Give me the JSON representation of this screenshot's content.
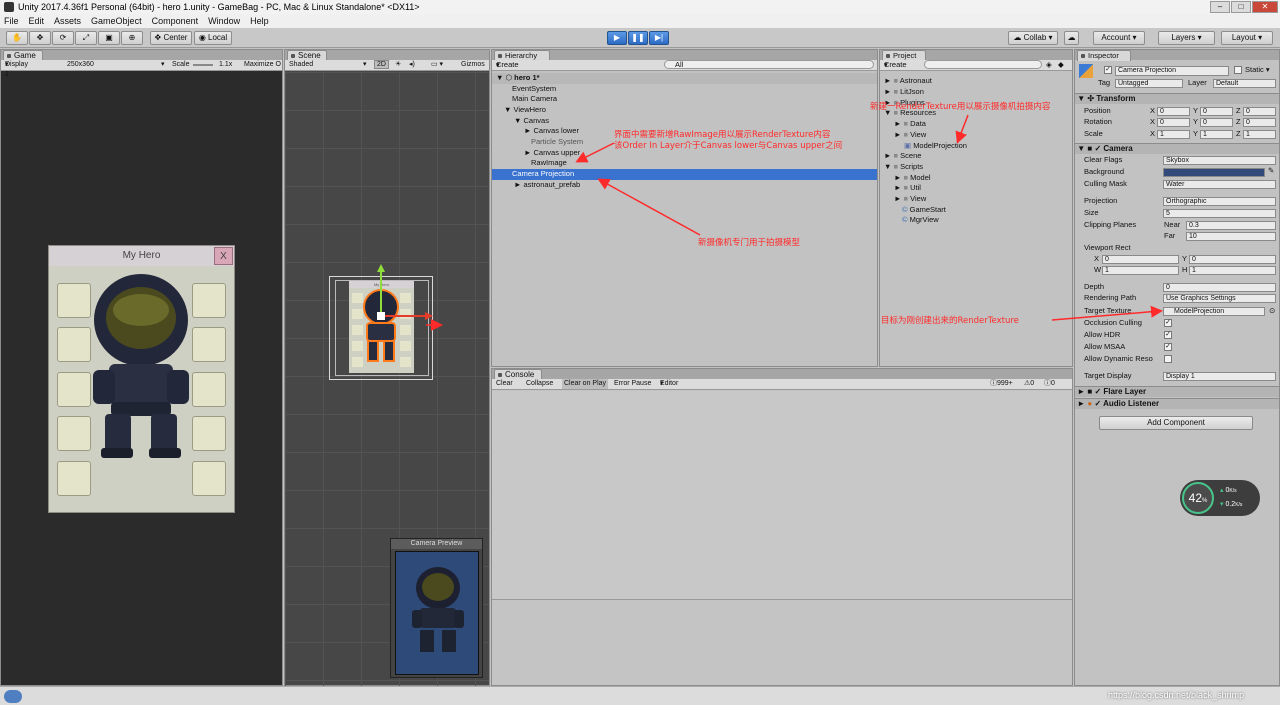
{
  "window": {
    "title": "Unity 2017.4.36f1 Personal (64bit) - hero 1.unity - GameBag - PC, Mac & Linux Standalone* <DX11>"
  },
  "menu": [
    "File",
    "Edit",
    "Assets",
    "GameObject",
    "Component",
    "Window",
    "Help"
  ],
  "toolbar": {
    "center": "Center",
    "local": "Local",
    "collab": "Collab",
    "account": "Account",
    "layers": "Layers",
    "layout": "Layout"
  },
  "game": {
    "tab": "Game",
    "display": "Display 1",
    "resolution": "250x360",
    "scale_label": "Scale",
    "scale_value": "1.1x",
    "maximize": "Maximize O",
    "panel_title": "My Hero",
    "close": "X"
  },
  "scene": {
    "tab": "Scene",
    "shading": "Shaded",
    "mode2d": "2D",
    "gizmos": "Gizmos",
    "preview_title": "Camera Preview",
    "mini_title": "My Hero"
  },
  "hierarchy": {
    "tab": "Hierarchy",
    "create": "Create",
    "search": "All",
    "items": [
      {
        "label": "hero 1*",
        "depth": 0,
        "arrow": "▼"
      },
      {
        "label": "EventSystem",
        "depth": 1,
        "arrow": ""
      },
      {
        "label": "Main Camera",
        "depth": 1,
        "arrow": ""
      },
      {
        "label": "ViewHero",
        "depth": 1,
        "arrow": "▼"
      },
      {
        "label": "Canvas",
        "depth": 2,
        "arrow": "▼"
      },
      {
        "label": "Canvas lower",
        "depth": 3,
        "arrow": "►"
      },
      {
        "label": "Particle System",
        "depth": 3,
        "arrow": ""
      },
      {
        "label": "Canvas upper",
        "depth": 3,
        "arrow": "►"
      },
      {
        "label": "RawImage",
        "depth": 3,
        "arrow": ""
      },
      {
        "label": "Camera Projection",
        "depth": 1,
        "arrow": ""
      },
      {
        "label": "astronaut_prefab",
        "depth": 1,
        "arrow": "►"
      }
    ]
  },
  "project": {
    "tab": "Project",
    "create": "Create",
    "items": [
      {
        "label": "Astronaut",
        "depth": 0,
        "arrow": "►",
        "kind": "folder"
      },
      {
        "label": "LitJson",
        "depth": 0,
        "arrow": "►",
        "kind": "folder"
      },
      {
        "label": "Plugins",
        "depth": 0,
        "arrow": "►",
        "kind": "folder"
      },
      {
        "label": "Resources",
        "depth": 0,
        "arrow": "▼",
        "kind": "folder"
      },
      {
        "label": "Data",
        "depth": 1,
        "arrow": "►",
        "kind": "folder"
      },
      {
        "label": "View",
        "depth": 1,
        "arrow": "►",
        "kind": "folder"
      },
      {
        "label": "ModelProjection",
        "depth": 1,
        "arrow": "",
        "kind": "texture"
      },
      {
        "label": "Scene",
        "depth": 0,
        "arrow": "►",
        "kind": "folder"
      },
      {
        "label": "Scripts",
        "depth": 0,
        "arrow": "▼",
        "kind": "folder"
      },
      {
        "label": "Model",
        "depth": 1,
        "arrow": "►",
        "kind": "folder"
      },
      {
        "label": "Util",
        "depth": 1,
        "arrow": "►",
        "kind": "folder"
      },
      {
        "label": "View",
        "depth": 1,
        "arrow": "►",
        "kind": "folder"
      },
      {
        "label": "GameStart",
        "depth": 1,
        "arrow": "",
        "kind": "script"
      },
      {
        "label": "MgrView",
        "depth": 1,
        "arrow": "",
        "kind": "script"
      }
    ]
  },
  "console": {
    "tab": "Console",
    "clear": "Clear",
    "collapse": "Collapse",
    "clear_on_play": "Clear on Play",
    "error_pause": "Error Pause",
    "editor": "Editor",
    "count_info": "999+",
    "count_warn": "0",
    "count_err": "0"
  },
  "inspector": {
    "tab": "Inspector",
    "object_name": "Camera Projection",
    "static": "Static",
    "tag_label": "Tag",
    "tag_value": "Untagged",
    "layer_label": "Layer",
    "layer_value": "Default",
    "transform": {
      "title": "Transform",
      "rows": [
        {
          "label": "Position",
          "x": "0",
          "y": "0",
          "z": "0"
        },
        {
          "label": "Rotation",
          "x": "0",
          "y": "0",
          "z": "0"
        },
        {
          "label": "Scale",
          "x": "1",
          "y": "1",
          "z": "1"
        }
      ]
    },
    "camera": {
      "title": "Camera",
      "rows": [
        {
          "label": "Clear Flags",
          "value": "Skybox"
        },
        {
          "label": "Background",
          "value": ""
        },
        {
          "label": "Culling Mask",
          "value": "Water"
        },
        {
          "label": "Projection",
          "value": "Orthographic"
        },
        {
          "label": "Size",
          "value": "5"
        },
        {
          "label": "Clipping Planes",
          "near_label": "Near",
          "near": "0.3",
          "far_label": "Far",
          "far": "10"
        },
        {
          "label": "Viewport Rect",
          "x": "0",
          "y": "0",
          "w": "1",
          "h": "1"
        },
        {
          "label": "Depth",
          "value": "0"
        },
        {
          "label": "Rendering Path",
          "value": "Use Graphics Settings"
        },
        {
          "label": "Target Texture",
          "value": "ModelProjection"
        },
        {
          "label": "Occlusion Culling",
          "value": "✓"
        },
        {
          "label": "Allow HDR",
          "value": "✓"
        },
        {
          "label": "Allow MSAA",
          "value": "✓"
        },
        {
          "label": "Allow Dynamic Reso",
          "value": ""
        },
        {
          "label": "Target Display",
          "value": "Display 1"
        }
      ]
    },
    "flare_layer": "Flare Layer",
    "audio_listener": "Audio Listener",
    "add_component": "Add Component"
  },
  "net_widget": {
    "percent": "42",
    "unit": "%",
    "up": "0",
    "up_unit": "K/s",
    "down": "0.2",
    "down_unit": "K/s"
  },
  "annotations": {
    "rawimage": "界面中需要新增RawImage用以展示RenderTexture内容\n该Order In Layer介于Canvas lower与Canvas upper之间",
    "camera": "新摄像机专门用于拍摄模型",
    "resources": "新建一RenderTexture用以展示摄像机拍摄内容",
    "target": "目标为刚创建出来的RenderTexture"
  },
  "watermark": "https://blog.csdn.net/black_shrimp",
  "colors": {
    "selection": "#3a72d0",
    "annotation": "#ff2a2a",
    "background_swatch": "#314a7a",
    "preview_bg": "#2e4a78"
  }
}
